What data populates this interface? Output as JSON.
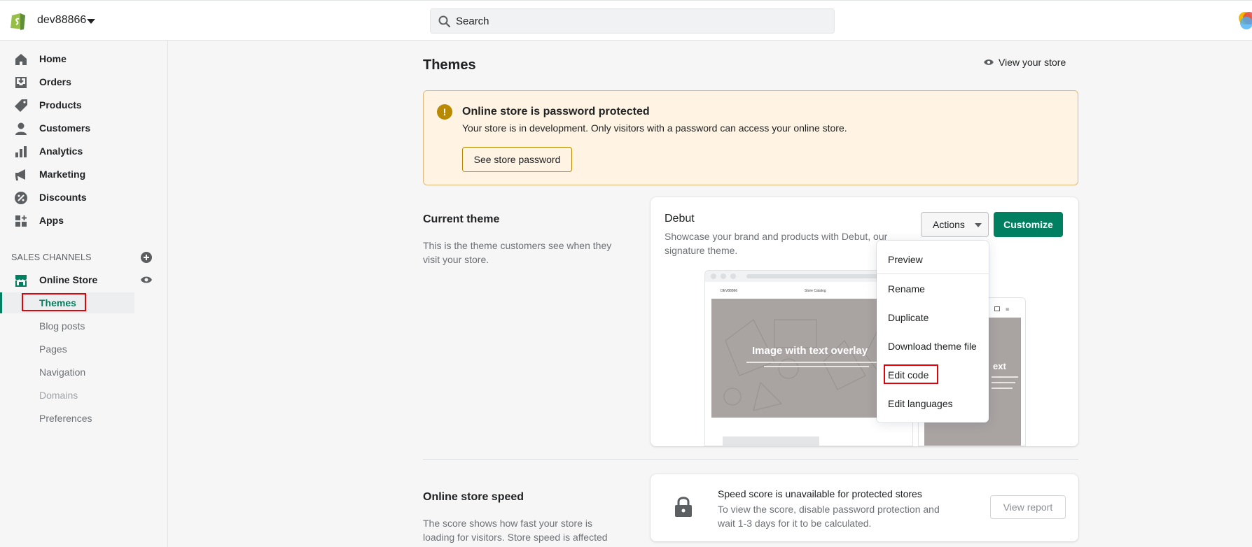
{
  "header": {
    "store_name": "dev88866",
    "search_placeholder": "Search"
  },
  "sidebar": {
    "items": [
      {
        "label": "Home",
        "icon": "home-icon"
      },
      {
        "label": "Orders",
        "icon": "orders-icon"
      },
      {
        "label": "Products",
        "icon": "tag-icon"
      },
      {
        "label": "Customers",
        "icon": "person-icon"
      },
      {
        "label": "Analytics",
        "icon": "bar-chart-icon"
      },
      {
        "label": "Marketing",
        "icon": "megaphone-icon"
      },
      {
        "label": "Discounts",
        "icon": "discount-icon"
      },
      {
        "label": "Apps",
        "icon": "apps-icon"
      }
    ],
    "sales_channels_title": "SALES CHANNELS",
    "online_store_label": "Online Store",
    "sub_items": [
      {
        "label": "Themes",
        "active": true
      },
      {
        "label": "Blog posts"
      },
      {
        "label": "Pages"
      },
      {
        "label": "Navigation"
      },
      {
        "label": "Domains"
      },
      {
        "label": "Preferences"
      }
    ]
  },
  "main": {
    "page_title": "Themes",
    "view_store_label": "View your store",
    "banner": {
      "title": "Online store is password protected",
      "text": "Your store is in development. Only visitors with a password can access your online store.",
      "button_label": "See store password"
    },
    "current_theme": {
      "section_title": "Current theme",
      "section_desc": "This is the theme customers see when they visit your store.",
      "theme_name": "Debut",
      "theme_desc": "Showcase your brand and products with Debut, our signature theme.",
      "actions_label": "Actions",
      "customize_label": "Customize",
      "preview_hero_text": "Image with text overlay",
      "preview_mobile_text": "ext",
      "preview_store_mark": "DEV88866",
      "preview_nav_links": "Store   Catalog"
    },
    "actions_menu": [
      "Preview",
      "Rename",
      "Duplicate",
      "Download theme file",
      "Edit code",
      "Edit languages"
    ],
    "speed": {
      "section_title": "Online store speed",
      "section_desc": "The score shows how fast your store is loading for visitors. Store speed is affected by",
      "card_title": "Speed score is unavailable for protected stores",
      "card_text": "To view the score, disable password protection and wait 1-3 days for it to be calculated.",
      "report_label": "View report"
    }
  },
  "colors": {
    "accent": "#008060",
    "banner_bg": "#fff4e4",
    "warning": "#b98900",
    "highlight": "#e0040a"
  }
}
